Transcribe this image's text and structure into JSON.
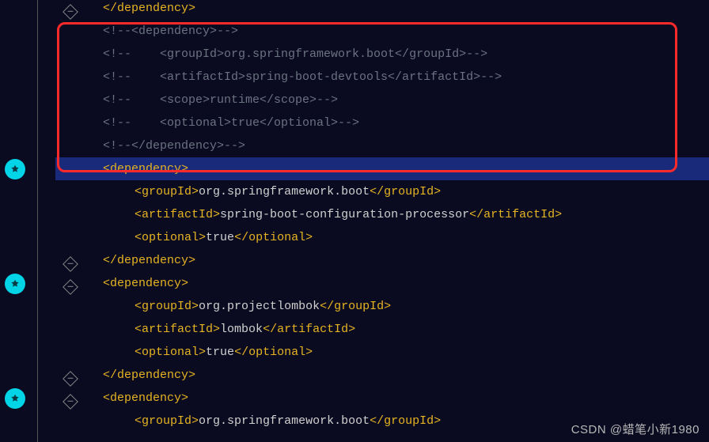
{
  "watermark": "CSDN @蜡笔小新1980",
  "lines": [
    {
      "indent": 1,
      "type": "close",
      "tag": "dependency",
      "hl": false
    },
    {
      "indent": 1,
      "type": "comment",
      "text": "<!--<dependency>-->"
    },
    {
      "indent": 1,
      "type": "comment",
      "text": "<!--    <groupId>org.springframework.boot</groupId>-->"
    },
    {
      "indent": 1,
      "type": "comment",
      "text": "<!--    <artifactId>spring-boot-devtools</artifactId>-->"
    },
    {
      "indent": 1,
      "type": "comment",
      "text": "<!--    <scope>runtime</scope>-->"
    },
    {
      "indent": 1,
      "type": "comment",
      "text": "<!--    <optional>true</optional>-->"
    },
    {
      "indent": 1,
      "type": "comment",
      "text": "<!--</dependency>-->"
    },
    {
      "indent": 1,
      "type": "open",
      "tag": "dependency",
      "hl": true
    },
    {
      "indent": 2,
      "type": "full",
      "tag": "groupId",
      "text": "org.springframework.boot"
    },
    {
      "indent": 2,
      "type": "full",
      "tag": "artifactId",
      "text": "spring-boot-configuration-processor"
    },
    {
      "indent": 2,
      "type": "full",
      "tag": "optional",
      "text": "true"
    },
    {
      "indent": 1,
      "type": "close",
      "tag": "dependency"
    },
    {
      "indent": 1,
      "type": "open",
      "tag": "dependency"
    },
    {
      "indent": 2,
      "type": "full",
      "tag": "groupId",
      "text": "org.projectlombok"
    },
    {
      "indent": 2,
      "type": "full",
      "tag": "artifactId",
      "text": "lombok"
    },
    {
      "indent": 2,
      "type": "full",
      "tag": "optional",
      "text": "true"
    },
    {
      "indent": 1,
      "type": "close",
      "tag": "dependency"
    },
    {
      "indent": 1,
      "type": "open",
      "tag": "dependency"
    },
    {
      "indent": 2,
      "type": "full",
      "tag": "groupId",
      "text": "org.springframework.boot"
    }
  ],
  "breakpoints": [
    7,
    12,
    17
  ],
  "folds": [
    0,
    7,
    11,
    12,
    16,
    17
  ]
}
